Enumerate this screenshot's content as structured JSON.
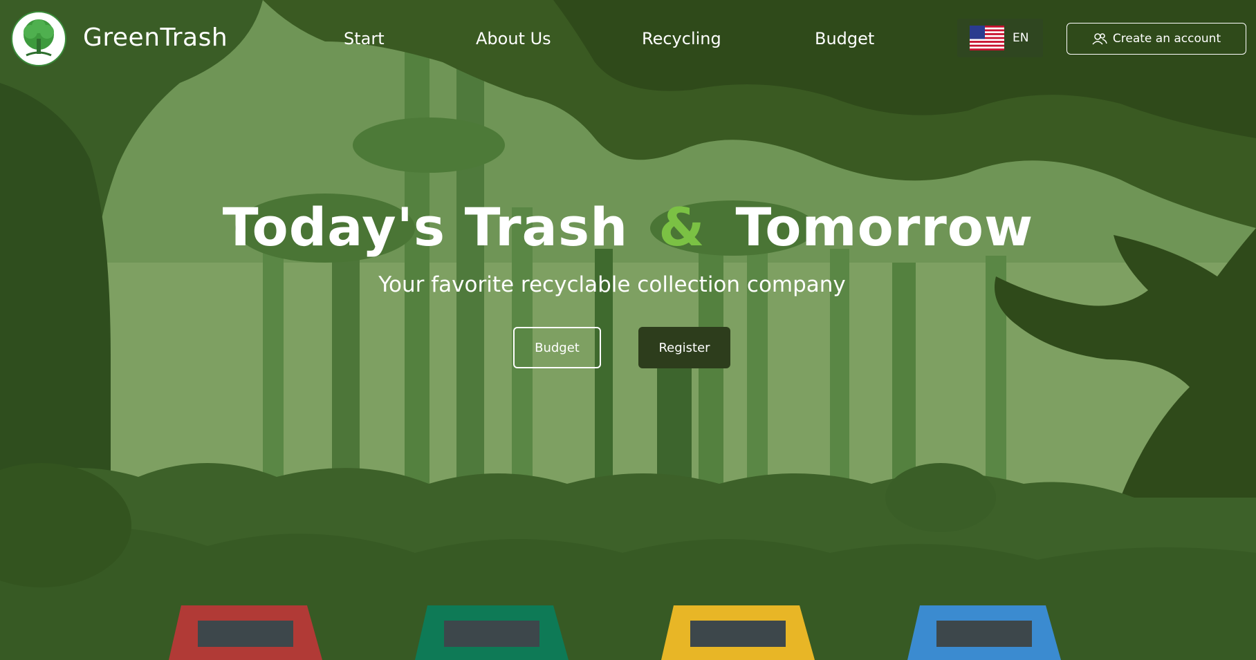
{
  "header": {
    "brand": "GreenTrash",
    "nav": [
      "Start",
      "About Us",
      "Recycling",
      "Budget"
    ],
    "language": "EN",
    "create_account": "Create an account"
  },
  "hero": {
    "title_part1": "Today's Trash",
    "title_amp": "&",
    "title_part2": "Tomorrow",
    "subtitle": "Your favorite recyclable collection company",
    "budget_button": "Budget",
    "register_button": "Register"
  },
  "icons": {
    "logo": "tree-logo-icon",
    "flag": "us-flag-icon",
    "account": "users-icon"
  },
  "colors": {
    "accent": "#7bc144",
    "dark_button": "#2d3d1c",
    "bins": [
      "#b13a36",
      "#0e7a56",
      "#e8b626",
      "#3b8bd0"
    ]
  }
}
